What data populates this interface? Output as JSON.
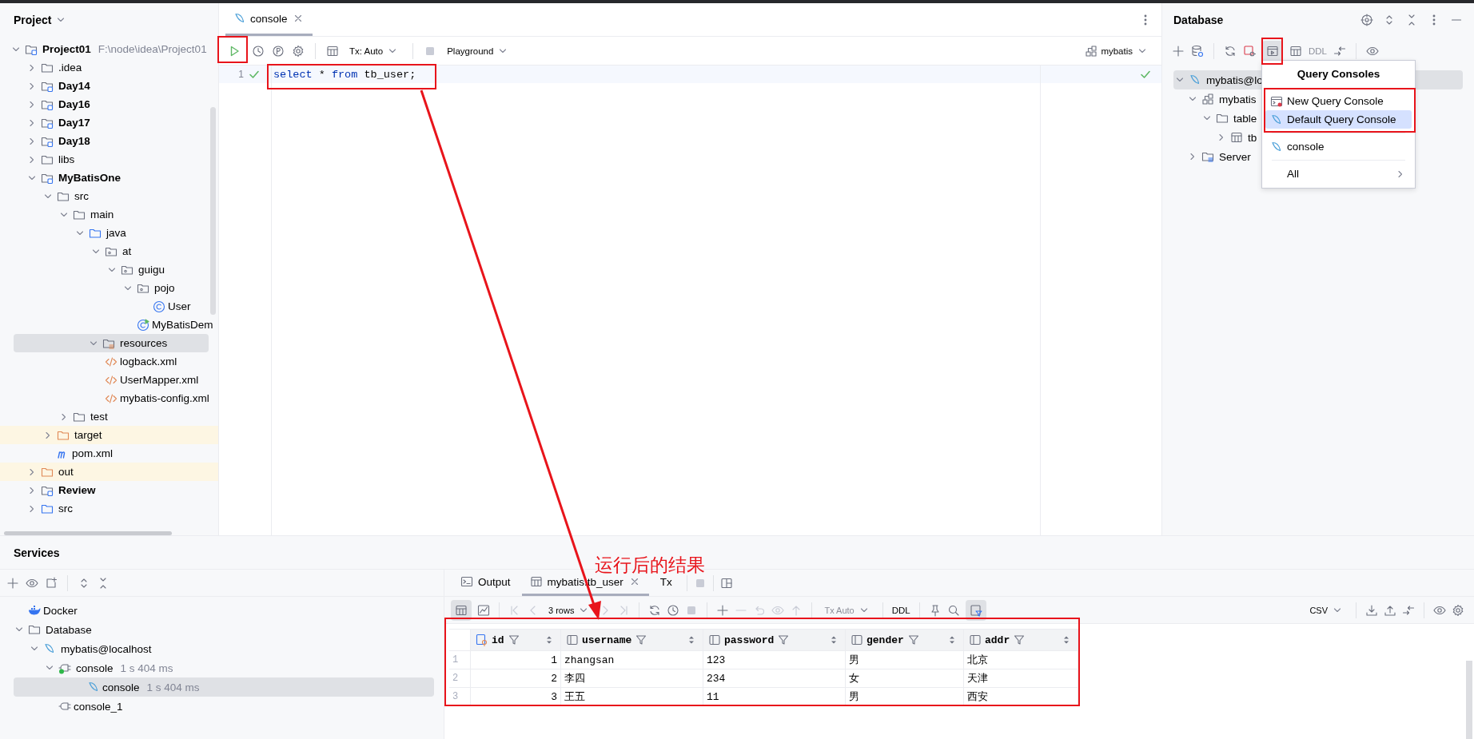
{
  "project": {
    "title": "Project",
    "tree": [
      {
        "label": "Project01",
        "path": "F:\\node\\idea\\Project01",
        "kind": "module",
        "expanded": true,
        "selected": false,
        "children": [
          {
            "label": ".idea",
            "kind": "folder",
            "expanded": false,
            "selected": false
          },
          {
            "label": "Day14",
            "kind": "module",
            "expanded": false,
            "selected": false
          },
          {
            "label": "Day16",
            "kind": "module",
            "expanded": false,
            "selected": false
          },
          {
            "label": "Day17",
            "kind": "module",
            "expanded": false,
            "selected": false
          },
          {
            "label": "Day18",
            "kind": "module",
            "expanded": false,
            "selected": false
          },
          {
            "label": "libs",
            "kind": "folder",
            "expanded": false,
            "selected": false
          },
          {
            "label": "MyBatisOne",
            "kind": "module",
            "expanded": true,
            "selected": false,
            "children": [
              {
                "label": "src",
                "kind": "folder",
                "expanded": true,
                "selected": false,
                "children": [
                  {
                    "label": "main",
                    "kind": "folder",
                    "expanded": true,
                    "selected": false,
                    "children": [
                      {
                        "label": "java",
                        "kind": "source-root",
                        "expanded": true,
                        "selected": false,
                        "children": [
                          {
                            "label": "at",
                            "kind": "package",
                            "expanded": true,
                            "selected": false,
                            "children": [
                              {
                                "label": "guigu",
                                "kind": "package",
                                "expanded": true,
                                "selected": false,
                                "children": [
                                  {
                                    "label": "pojo",
                                    "kind": "package",
                                    "expanded": true,
                                    "selected": false,
                                    "children": [
                                      {
                                        "label": "User",
                                        "kind": "class",
                                        "selected": false
                                      }
                                    ]
                                  },
                                  {
                                    "label": "MyBatisDem",
                                    "kind": "runnable-class",
                                    "selected": false
                                  }
                                ]
                              }
                            ]
                          }
                        ]
                      },
                      {
                        "label": "resources",
                        "kind": "resource-root",
                        "expanded": true,
                        "selected": true,
                        "children": [
                          {
                            "label": "logback.xml",
                            "kind": "xml",
                            "selected": false
                          },
                          {
                            "label": "UserMapper.xml",
                            "kind": "xml",
                            "selected": false
                          },
                          {
                            "label": "mybatis-config.xml",
                            "kind": "xml",
                            "selected": false
                          }
                        ]
                      }
                    ]
                  },
                  {
                    "label": "test",
                    "kind": "folder",
                    "expanded": false,
                    "selected": false
                  }
                ]
              },
              {
                "label": "target",
                "kind": "excluded",
                "expanded": false,
                "selected": false
              },
              {
                "label": "pom.xml",
                "kind": "maven",
                "selected": false
              }
            ]
          },
          {
            "label": "out",
            "kind": "excluded",
            "expanded": false,
            "selected": false
          },
          {
            "label": "Review",
            "kind": "module",
            "expanded": false,
            "selected": false
          },
          {
            "label": "src",
            "kind": "source-root",
            "expanded": false,
            "selected": false
          }
        ]
      }
    ]
  },
  "editor": {
    "tab": {
      "label": "console",
      "selected": true
    },
    "toolbar": {
      "transaction": "Tx: Auto",
      "mode": "Playground",
      "schema": "mybatis"
    },
    "lines": [
      {
        "number": "1",
        "ok": true,
        "tokens": [
          {
            "text": "select",
            "kind": "keyword"
          },
          {
            "text": " * ",
            "kind": "plain"
          },
          {
            "text": "from",
            "kind": "keyword"
          },
          {
            "text": " tb_user",
            "kind": "plain"
          },
          {
            "text": ";",
            "kind": "plain"
          }
        ]
      }
    ]
  },
  "database": {
    "title": "Database",
    "ddl": "DDL",
    "tree": [
      {
        "label": "mybatis@lo",
        "kind": "datasource",
        "expanded": true,
        "selected": true,
        "children": [
          {
            "label": "mybatis",
            "kind": "schema",
            "expanded": true,
            "selected": false,
            "children": [
              {
                "label": "table",
                "kind": "folder",
                "expanded": true,
                "selected": false,
                "children": [
                  {
                    "label": "tb",
                    "kind": "table",
                    "expanded": false,
                    "selected": false
                  }
                ]
              }
            ]
          },
          {
            "label": "Server",
            "kind": "server-objects",
            "expanded": false,
            "selected": false
          }
        ]
      }
    ],
    "menu": {
      "title": "Query Consoles",
      "items": [
        {
          "label": "New Query Console",
          "kind": "new-console",
          "selected": false
        },
        {
          "label": "Default Query Console",
          "kind": "console",
          "selected": true
        },
        {
          "kind": "separator"
        },
        {
          "label": "console",
          "kind": "console",
          "selected": false
        },
        {
          "kind": "separator"
        },
        {
          "label": "All",
          "kind": "submenu",
          "selected": false
        }
      ]
    }
  },
  "services": {
    "title": "Services",
    "tree": [
      {
        "label": "Docker",
        "kind": "docker",
        "selected": false
      },
      {
        "label": "Database",
        "kind": "folder",
        "expanded": true,
        "selected": false,
        "children": [
          {
            "label": "mybatis@localhost",
            "kind": "datasource",
            "expanded": true,
            "selected": false,
            "children": [
              {
                "label": "console",
                "time": "1 s 404 ms",
                "kind": "session",
                "active": true,
                "expanded": true,
                "selected": false,
                "children": [
                  {
                    "label": "console",
                    "time": "1 s 404 ms",
                    "kind": "console",
                    "selected": true
                  }
                ]
              },
              {
                "label": "console_1",
                "kind": "session",
                "active": false,
                "selected": false
              }
            ]
          }
        ]
      }
    ]
  },
  "results": {
    "tabs": [
      {
        "label": "Output",
        "kind": "output",
        "selected": false
      },
      {
        "label": "mybatis.tb_user",
        "kind": "table",
        "selected": true
      },
      {
        "label": "Tx",
        "kind": "tx",
        "selected": false
      }
    ],
    "toolbar": {
      "rows": "3 rows",
      "transaction": "Tx Auto",
      "ddl": "DDL",
      "format": "CSV"
    },
    "columns": [
      {
        "name": "id",
        "kind": "key"
      },
      {
        "name": "username",
        "kind": "column"
      },
      {
        "name": "password",
        "kind": "column"
      },
      {
        "name": "gender",
        "kind": "column"
      },
      {
        "name": "addr",
        "kind": "column"
      }
    ],
    "rows": [
      {
        "number": "1",
        "cells": [
          "1",
          "zhangsan",
          "123",
          "男",
          "北京"
        ]
      },
      {
        "number": "2",
        "cells": [
          "2",
          "李四",
          "234",
          "女",
          "天津"
        ]
      },
      {
        "number": "3",
        "cells": [
          "3",
          "王五",
          "11",
          "男",
          "西安"
        ]
      }
    ]
  },
  "annotation": {
    "caption": "运行后的结果"
  }
}
